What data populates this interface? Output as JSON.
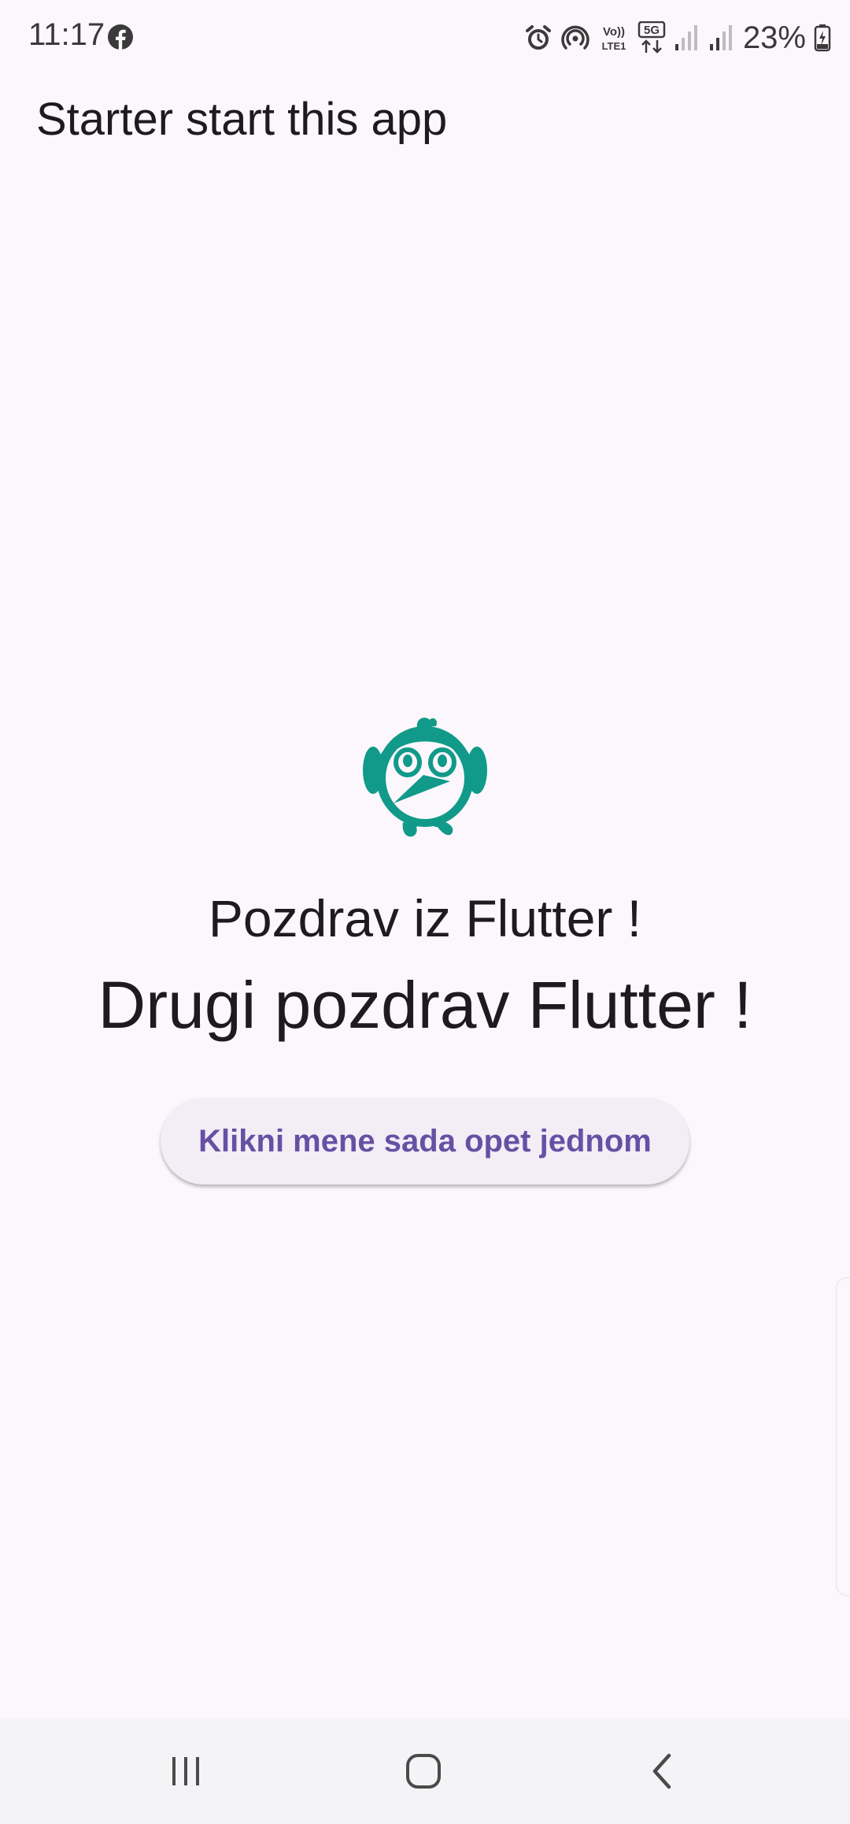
{
  "status_bar": {
    "time": "11:17",
    "battery_percent": "23%",
    "network_label": "5G",
    "icons": [
      "facebook-icon",
      "alarm-icon",
      "hotspot-icon",
      "volte-icon",
      "5g-icon",
      "signal-icon",
      "signal-icon",
      "battery-icon"
    ]
  },
  "app_bar": {
    "title": "Starter start this app"
  },
  "main": {
    "logo_icon": "owl-mascot-icon",
    "greeting_primary": "Pozdrav iz Flutter !",
    "greeting_secondary": "Drugi pozdrav Flutter !",
    "button_label": "Klikni mene sada opet jednom"
  },
  "nav_bar": {
    "items": [
      "recents-icon",
      "home-icon",
      "back-icon"
    ]
  },
  "colors": {
    "background": "#fcf7fc",
    "text": "#1d1b20",
    "button_text": "#6750a4",
    "button_bg": "#f3edf6",
    "mascot": "#119a8a"
  }
}
